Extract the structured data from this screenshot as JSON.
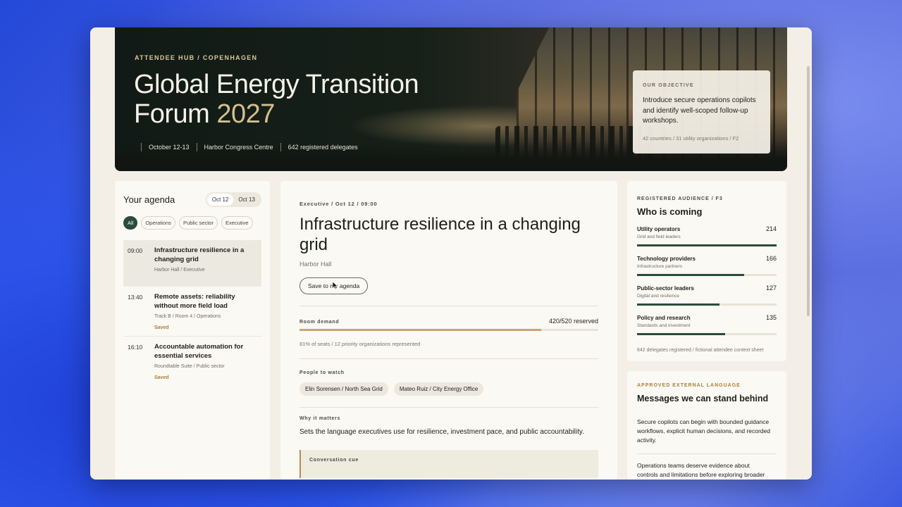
{
  "hero": {
    "eyebrow": "ATTENDEE HUB / COPENHAGEN",
    "title_main": "Global Energy Transition Forum",
    "title_year": "2027",
    "meta": [
      "October 12-13",
      "Harbor Congress Centre",
      "642 registered delegates"
    ],
    "objective": {
      "label": "OUR OBJECTIVE",
      "text": "Introduce secure operations copilots and identify well-scoped follow-up workshops.",
      "foot": "42 countries / 31 utility organizations / F2"
    }
  },
  "agenda": {
    "title": "Your agenda",
    "dates": [
      "Oct 12",
      "Oct 13"
    ],
    "filters": [
      "All",
      "Operations",
      "Public sector",
      "Executive"
    ],
    "sessions": [
      {
        "time": "09:00",
        "title": "Infrastructure resilience in a changing grid",
        "where": "Harbor Hall / Executive",
        "saved": ""
      },
      {
        "time": "13:40",
        "title": "Remote assets: reliability without more field load",
        "where": "Track B / Room 4 / Operations",
        "saved": "Saved"
      },
      {
        "time": "16:10",
        "title": "Accountable automation for essential services",
        "where": "Roundtable Suite / Public sector",
        "saved": "Saved"
      }
    ]
  },
  "detail": {
    "kicker": "Executive / Oct 12 / 09:00",
    "title": "Infrastructure resilience in a changing grid",
    "room": "Harbor Hall",
    "save_label": "Save to my agenda",
    "demand_label": "Room demand",
    "demand_value": "420/520 reserved",
    "demand_fraction": 0.81,
    "demand_note": "81% of seats / 12 priority organizations represented",
    "people_label": "People to watch",
    "people": [
      "Elin Sorensen / North Sea Grid",
      "Mateo Ruiz / City Energy Office"
    ],
    "why_label": "Why it matters",
    "why_text": "Sets the language executives use for resilience, investment pace, and public accountability.",
    "cue_label": "Conversation cue"
  },
  "audience": {
    "label": "REGISTERED AUDIENCE / F3",
    "title": "Who is coming",
    "rows": [
      {
        "name": "Utility operators",
        "desc": "Grid and field leaders",
        "count": "214",
        "fraction": 1.0
      },
      {
        "name": "Technology providers",
        "desc": "Infrastructure partners",
        "count": "166",
        "fraction": 0.77
      },
      {
        "name": "Public-sector leaders",
        "desc": "Digital and resilience",
        "count": "127",
        "fraction": 0.59
      },
      {
        "name": "Policy and research",
        "desc": "Standards and investment",
        "count": "135",
        "fraction": 0.63
      }
    ],
    "foot": "642 delegates registered / fictional attendee context sheet"
  },
  "messages": {
    "label": "APPROVED EXTERNAL LANGUAGE",
    "title": "Messages we can stand behind",
    "items": [
      "Secure copilots can begin with bounded guidance workflows, explicit human decisions, and recorded activity.",
      "Operations teams deserve evidence about controls and limitations before exploring broader rollout."
    ]
  }
}
